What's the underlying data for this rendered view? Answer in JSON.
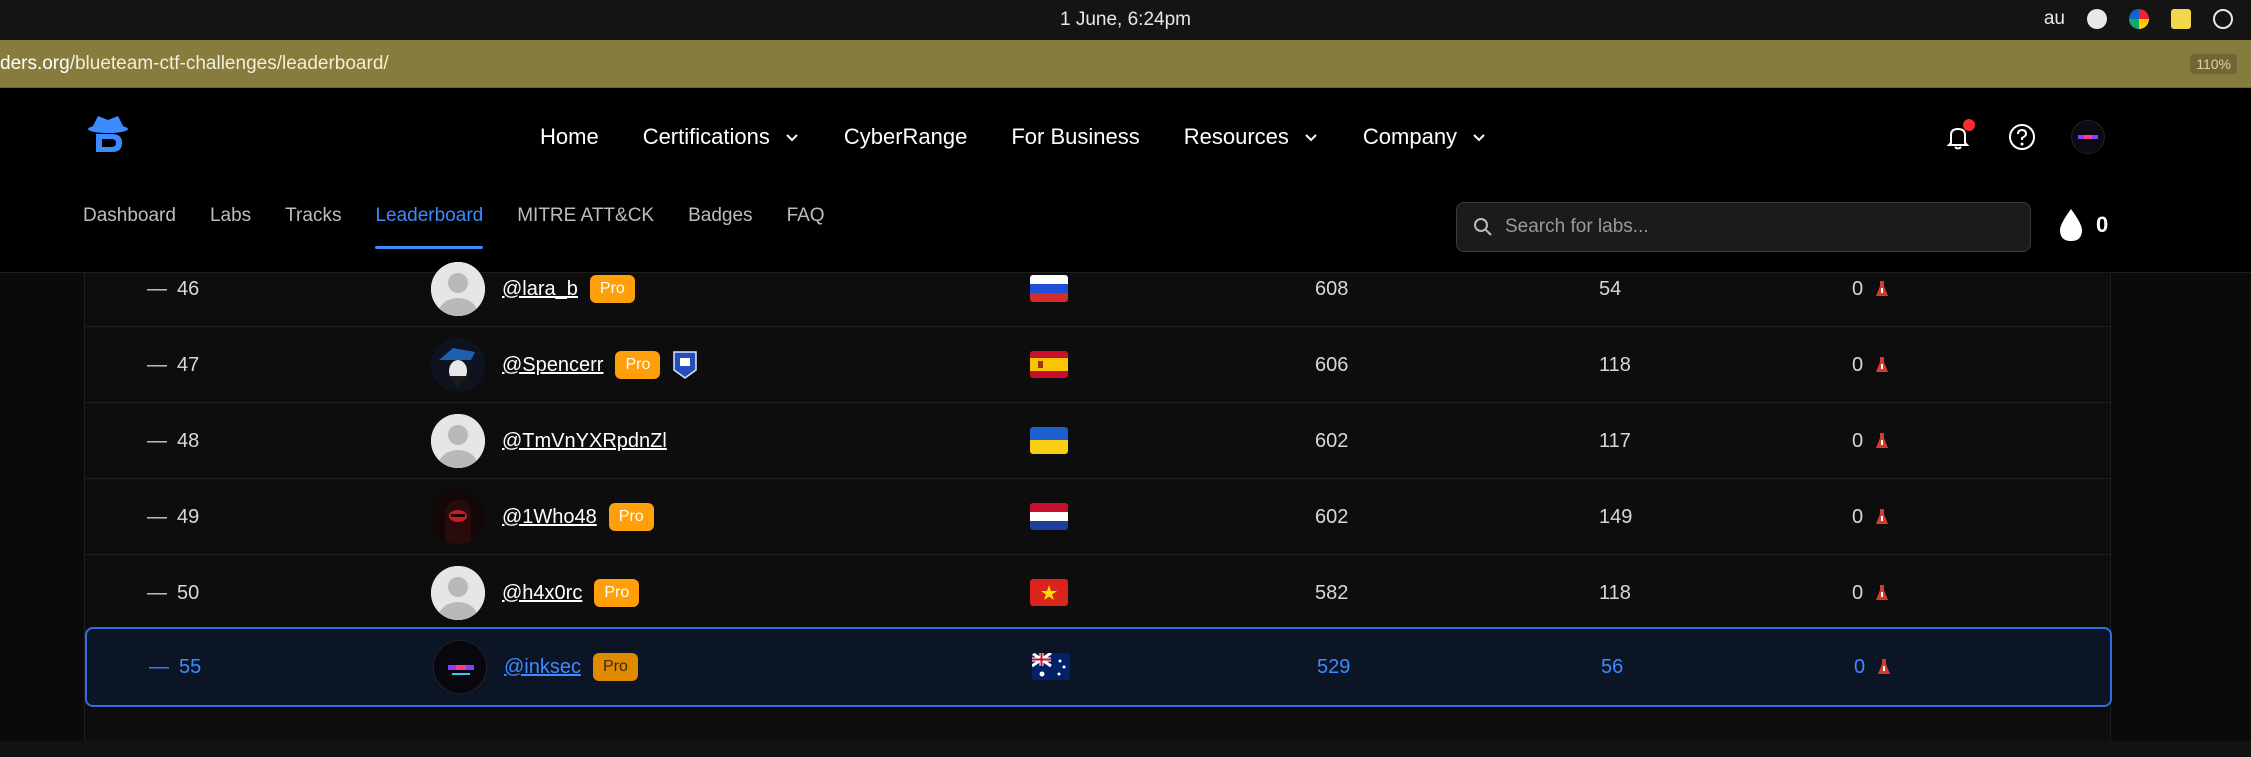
{
  "system": {
    "clock": "1 June, 6:24pm",
    "tray_text": "au"
  },
  "browser": {
    "url_host": "ders.org",
    "url_path": "/blueteam-ctf-challenges/leaderboard/",
    "zoom": "110%"
  },
  "header": {
    "nav": [
      {
        "label": "Home",
        "dropdown": false
      },
      {
        "label": "Certifications",
        "dropdown": true
      },
      {
        "label": "CyberRange",
        "dropdown": false
      },
      {
        "label": "For Business",
        "dropdown": false
      },
      {
        "label": "Resources",
        "dropdown": true
      },
      {
        "label": "Company",
        "dropdown": true
      }
    ]
  },
  "subnav": {
    "tabs": [
      "Dashboard",
      "Labs",
      "Tracks",
      "Leaderboard",
      "MITRE ATT&CK",
      "Badges",
      "FAQ"
    ],
    "active": "Leaderboard"
  },
  "search": {
    "placeholder": "Search for labs..."
  },
  "points_total": "0",
  "leaderboard": {
    "rows": [
      {
        "dash": "—",
        "rank": "46",
        "user": "@lara_b",
        "pro": "Pro",
        "country": "russia",
        "points": "608",
        "labs": "54",
        "streak": "0",
        "avatar": "default",
        "badge": false
      },
      {
        "dash": "—",
        "rank": "47",
        "user": "@Spencerr",
        "pro": "Pro",
        "country": "spain",
        "points": "606",
        "labs": "118",
        "streak": "0",
        "avatar": "dark-hat",
        "badge": true
      },
      {
        "dash": "—",
        "rank": "48",
        "user": "@TmVnYXRpdnZl",
        "pro": "",
        "country": "ukraine",
        "points": "602",
        "labs": "117",
        "streak": "0",
        "avatar": "default",
        "badge": false
      },
      {
        "dash": "—",
        "rank": "49",
        "user": "@1Who48",
        "pro": "Pro",
        "country": "netherlands",
        "points": "602",
        "labs": "149",
        "streak": "0",
        "avatar": "red-hood",
        "badge": false
      },
      {
        "dash": "—",
        "rank": "50",
        "user": "@h4x0rc",
        "pro": "Pro",
        "country": "vietnam",
        "points": "582",
        "labs": "118",
        "streak": "0",
        "avatar": "default",
        "badge": false
      },
      {
        "dash": "—",
        "rank": "55",
        "user": "@inksec",
        "pro": "Pro",
        "country": "australia",
        "points": "529",
        "labs": "56",
        "streak": "0",
        "avatar": "dark-logo",
        "badge": false,
        "current_user": true
      }
    ]
  },
  "colors": {
    "accent": "#3d8bff",
    "pro_badge": "#ff9f0a",
    "url_bar": "#857c3e"
  }
}
